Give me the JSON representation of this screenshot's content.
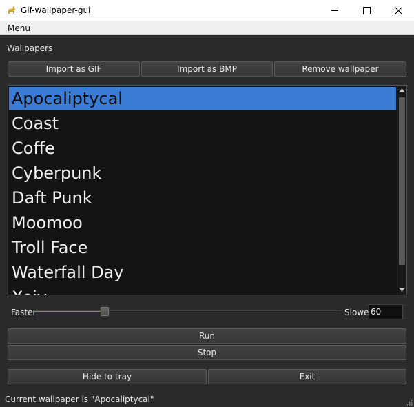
{
  "window": {
    "title": "Gif-wallpaper-gui"
  },
  "menubar": {
    "menu_label": "Menu"
  },
  "wallpapers": {
    "section_label": "Wallpapers",
    "import_gif_label": "Import as GIF",
    "import_bmp_label": "Import as BMP",
    "remove_label": "Remove wallpaper",
    "items": [
      "Apocaliptycal",
      "Coast",
      "Coffe",
      "Cyberpunk",
      "Daft Punk",
      "Moomoo",
      "Troll Face",
      "Waterfall Day",
      "Xeiv"
    ],
    "selected": "Apocaliptycal"
  },
  "speed": {
    "faster_label": "Faster",
    "slower_label": "Slower",
    "value": "60",
    "slider_level": 0.23
  },
  "controls": {
    "run_label": "Run",
    "stop_label": "Stop",
    "hide_label": "Hide to tray",
    "exit_label": "Exit"
  },
  "status": {
    "text": "Current wallpaper is \"Apocaliptycal\""
  },
  "colors": {
    "selection": "#3a7bd5",
    "slider_fill": "#4a8fe0",
    "background": "#2b2b2b"
  }
}
